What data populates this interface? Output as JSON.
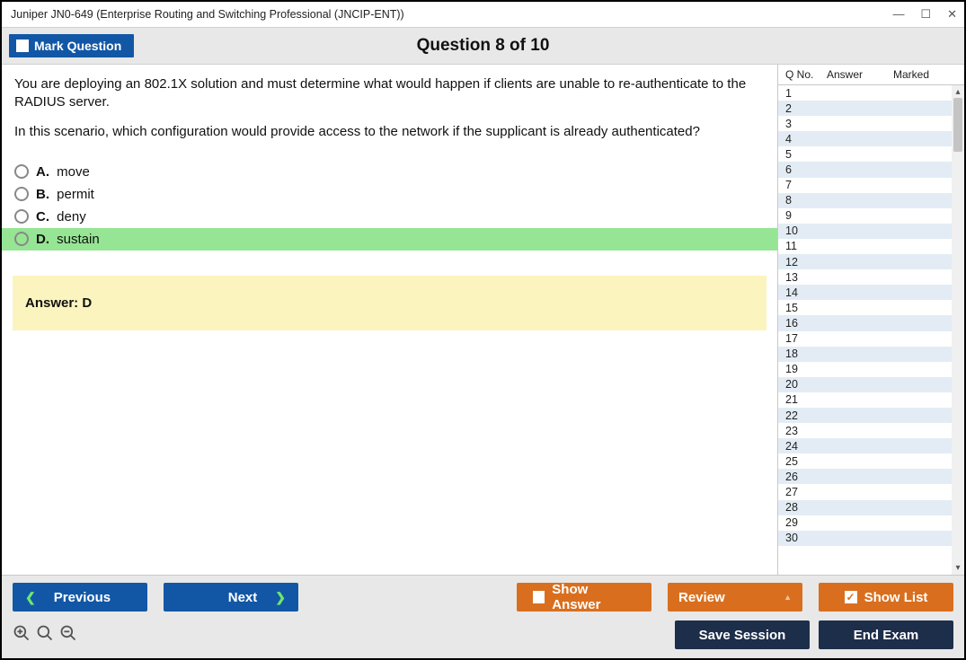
{
  "window": {
    "title": "Juniper JN0-649 (Enterprise Routing and Switching Professional (JNCIP-ENT))"
  },
  "header": {
    "mark_label": "Mark Question",
    "question_title": "Question 8 of 10"
  },
  "question": {
    "para1": "You are deploying an 802.1X solution and must determine what would happen if clients are unable to re-authenticate to the RADIUS server.",
    "para2": "In this scenario, which configuration would provide access to the network if the supplicant is already authenticated?",
    "choices": [
      {
        "letter": "A.",
        "text": "move",
        "correct": false
      },
      {
        "letter": "B.",
        "text": "permit",
        "correct": false
      },
      {
        "letter": "C.",
        "text": "deny",
        "correct": false
      },
      {
        "letter": "D.",
        "text": "sustain",
        "correct": true
      }
    ],
    "answer_label": "Answer: D"
  },
  "sidepanel": {
    "col1": "Q No.",
    "col2": "Answer",
    "col3": "Marked",
    "row_count": 30
  },
  "footer": {
    "previous": "Previous",
    "next": "Next",
    "show_answer": "Show Answer",
    "review": "Review",
    "show_list": "Show List",
    "save_session": "Save Session",
    "end_exam": "End Exam"
  }
}
